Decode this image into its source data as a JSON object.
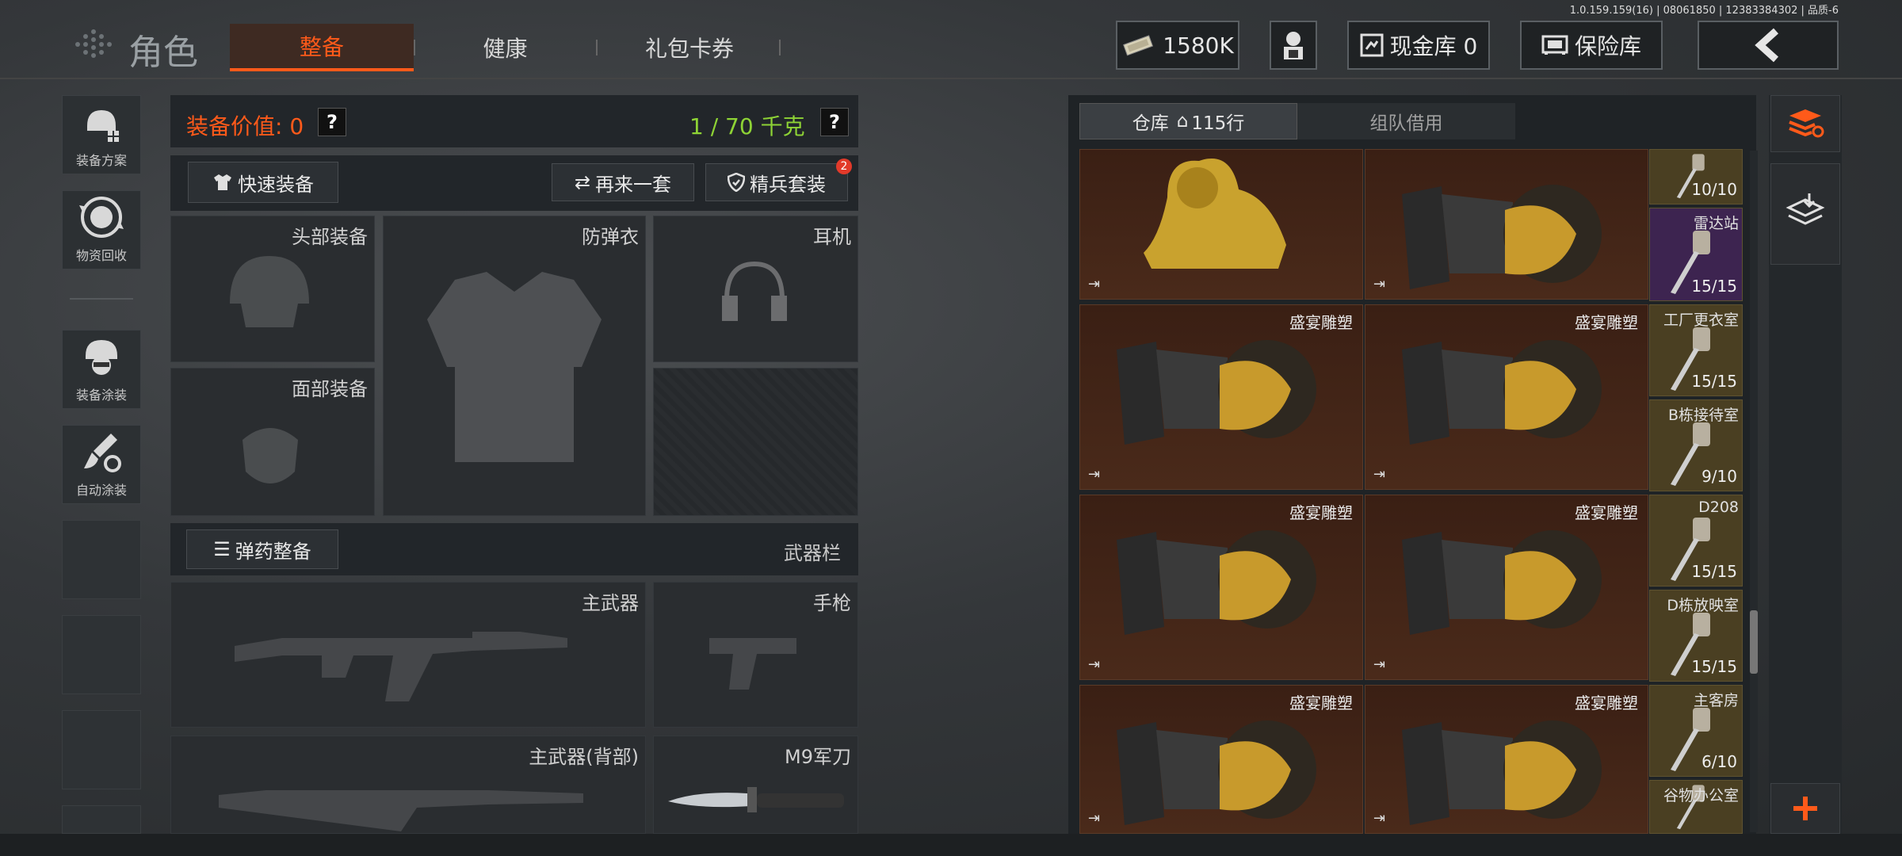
{
  "version_text": "1.0.159.159(16) | 08061850 | 12383384302 | 品质-6",
  "header": {
    "title": "角色",
    "tabs": [
      {
        "label": "整备",
        "active": true
      },
      {
        "label": "健康",
        "active": false
      },
      {
        "label": "礼包卡券",
        "active": false
      }
    ],
    "currency": {
      "value": "1580K",
      "icon": "cash-icon"
    },
    "cash_vault": {
      "label": "现金库 0"
    },
    "insurance": {
      "label": "保险库"
    },
    "accent_color": "#ff5a1a"
  },
  "sidebar": {
    "items": [
      {
        "label": "装备方案",
        "icon": "loadout-icon"
      },
      {
        "label": "物资回收",
        "icon": "recycle-icon"
      },
      {
        "label": "装备涂装",
        "icon": "helmet-paint-icon"
      },
      {
        "label": "自动涂装",
        "icon": "auto-paint-icon"
      }
    ]
  },
  "equipment": {
    "value_label": "装备价值: 0",
    "weight_label": "1 / 70 千克",
    "quick_equip": "快速装备",
    "again": "再来一套",
    "elite": "精兵套装",
    "elite_badge": "2",
    "slots": {
      "head": "头部装备",
      "armor": "防弹衣",
      "headset": "耳机",
      "face": "面部装备"
    },
    "ammo_button": "弹药整备",
    "weapons_label": "武器栏",
    "weapon_slots": {
      "primary": "主武器",
      "pistol": "手枪",
      "primary_back": "主武器(背部)",
      "knife": "M9军刀"
    }
  },
  "inventory": {
    "tab_warehouse": "仓库",
    "warehouse_rows": "115行",
    "tab_team": "组队借用",
    "items": [
      {
        "name": "",
        "kind": "lion"
      },
      {
        "name": "",
        "kind": "bust"
      },
      {
        "name": "盛宴雕塑",
        "kind": "bust"
      },
      {
        "name": "盛宴雕塑",
        "kind": "bust"
      },
      {
        "name": "盛宴雕塑",
        "kind": "bust"
      },
      {
        "name": "盛宴雕塑",
        "kind": "bust"
      },
      {
        "name": "盛宴雕塑",
        "kind": "bust"
      },
      {
        "name": "盛宴雕塑",
        "kind": "bust"
      }
    ],
    "keys": [
      {
        "name": "",
        "count": "10/10",
        "color": "#4a3f22"
      },
      {
        "name": "雷达站",
        "count": "15/15",
        "color": "#3d2450"
      },
      {
        "name": "工厂更衣室",
        "count": "15/15",
        "color": "#4a3f22"
      },
      {
        "name": "B栋接待室",
        "count": "9/10",
        "color": "#4a3f22"
      },
      {
        "name": "D208",
        "count": "15/15",
        "color": "#4a3f22"
      },
      {
        "name": "D栋放映室",
        "count": "15/15",
        "color": "#4a3f22"
      },
      {
        "name": "主客房",
        "count": "6/10",
        "color": "#4a3f22"
      },
      {
        "name": "谷物办公室",
        "count": "",
        "color": "#4a3f22"
      }
    ]
  }
}
